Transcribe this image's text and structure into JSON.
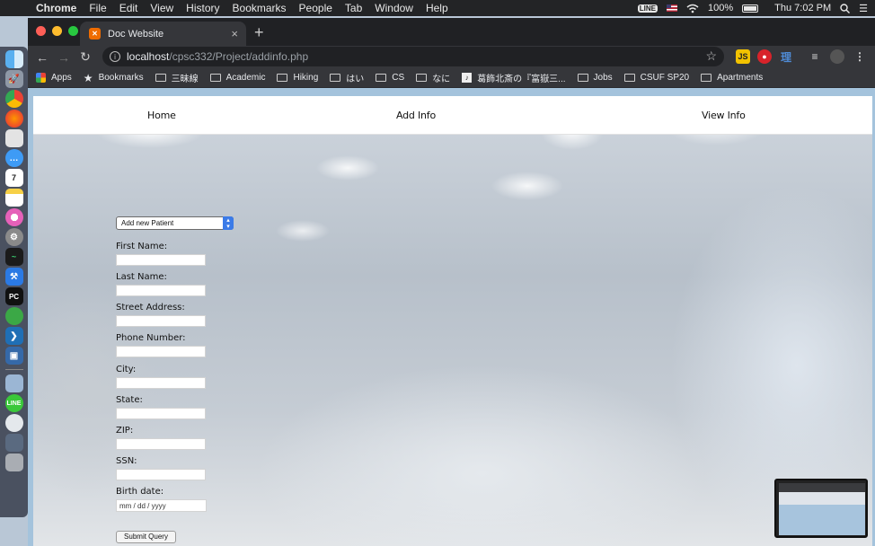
{
  "menubar": {
    "app": "Chrome",
    "items": [
      "File",
      "Edit",
      "View",
      "History",
      "Bookmarks",
      "People",
      "Tab",
      "Window",
      "Help"
    ],
    "line_badge": "LINE",
    "battery": "100%",
    "clock": "Thu 7:02 PM"
  },
  "browser": {
    "tab_title": "Doc Website",
    "url_host": "localhost",
    "url_path": "/cpsc332/Project/addinfo.php",
    "bookmarks": [
      {
        "label": "Apps",
        "icon": "apps-icon"
      },
      {
        "label": "Bookmarks",
        "icon": "star-icon"
      },
      {
        "label": "三昧線",
        "icon": "folder-icon"
      },
      {
        "label": "Academic",
        "icon": "folder-icon"
      },
      {
        "label": "Hiking",
        "icon": "folder-icon"
      },
      {
        "label": "はい",
        "icon": "folder-icon"
      },
      {
        "label": "CS",
        "icon": "folder-icon"
      },
      {
        "label": "なに",
        "icon": "folder-icon"
      },
      {
        "label": "葛飾北斎の『富嶽三...",
        "icon": "page-icon"
      },
      {
        "label": "Jobs",
        "icon": "folder-icon"
      },
      {
        "label": "CSUF SP20",
        "icon": "folder-icon"
      },
      {
        "label": "Apartments",
        "icon": "folder-icon"
      }
    ]
  },
  "nav": {
    "home": "Home",
    "add_info": "Add Info",
    "view_info": "View Info"
  },
  "form": {
    "select_value": "Add new Patient",
    "fields": [
      {
        "label": "First Name:"
      },
      {
        "label": "Last Name:"
      },
      {
        "label": "Street Address:"
      },
      {
        "label": "Phone Number:"
      },
      {
        "label": "City:"
      },
      {
        "label": "State:"
      },
      {
        "label": "ZIP:"
      },
      {
        "label": "SSN:"
      },
      {
        "label": "Birth date:"
      }
    ],
    "date_placeholder": "mm / dd / yyyy",
    "submit_label": "Submit Query"
  },
  "colors": {
    "chrome_dark": "#202124",
    "toolbar": "#35363a",
    "page_border": "#a4c3dc",
    "select_accent": "#3b7be8"
  }
}
